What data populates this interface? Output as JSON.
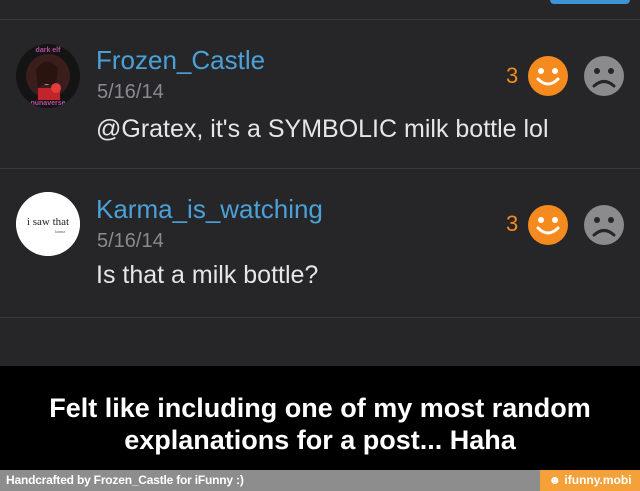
{
  "comments": [
    {
      "username": "Frozen_Castle",
      "date": "5/16/14",
      "text": "@Gratex, it's a SYMBOLIC milk bottle lol",
      "smile_count": "3",
      "avatar_arc_text": "dark · elf · punaverse"
    },
    {
      "username": "Karma_is_watching",
      "date": "5/16/14",
      "text": "Is that a milk bottle?",
      "smile_count": "3",
      "avatar_text": "i saw that",
      "avatar_subtext": "karma"
    }
  ],
  "caption": {
    "line1": "Felt like including one of my most random",
    "line2": "explanations for a post... Haha"
  },
  "footer": {
    "credit": "Handcrafted by Frozen_Castle for iFunny :)",
    "brand": "ifunny.mobi"
  },
  "colors": {
    "accent_blue": "#4aa1d8",
    "smile_orange": "#f58b1f",
    "background": "#262628"
  },
  "icons": [
    "smile-face-icon",
    "frown-face-icon"
  ]
}
